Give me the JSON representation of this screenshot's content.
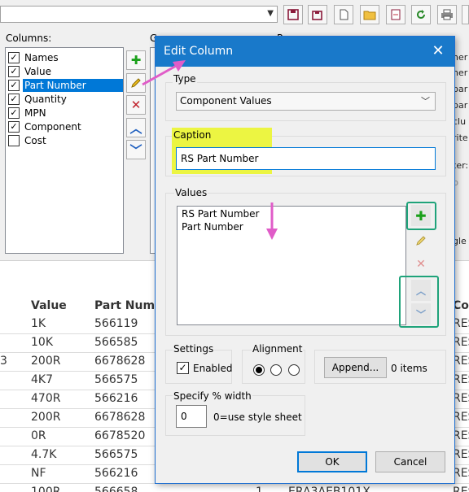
{
  "background": {
    "columns_label": "Columns:",
    "columns": [
      {
        "label": "Names",
        "checked": true,
        "selected": false
      },
      {
        "label": "Value",
        "checked": true,
        "selected": false
      },
      {
        "label": "Part Number",
        "checked": true,
        "selected": true
      },
      {
        "label": "Quantity",
        "checked": true,
        "selected": false
      },
      {
        "label": "MPN",
        "checked": true,
        "selected": false
      },
      {
        "label": "Component",
        "checked": true,
        "selected": false
      },
      {
        "label": "Cost",
        "checked": false,
        "selected": false
      }
    ],
    "partial_text": {
      "g": "G",
      "p": "P",
      "ner1": "ner",
      "ner2": "ner",
      "par1": "par",
      "par2": "par",
      "clu": "clu",
      "rite": "rite",
      "ter": "ter:",
      "p2": "p",
      "gle": "gle"
    },
    "table": {
      "headers": {
        "value": "Value",
        "part": "Part Num",
        "co": "Co"
      },
      "rows": [
        {
          "value": "1K",
          "part": "566119",
          "co": "RES"
        },
        {
          "value": "10K",
          "part": "566585",
          "co": "RES"
        },
        {
          "value": "200R",
          "part": "6678628",
          "co": "RES",
          "left": "3"
        },
        {
          "value": "4K7",
          "part": "566575",
          "co": "RES"
        },
        {
          "value": "470R",
          "part": "566216",
          "co": "RES"
        },
        {
          "value": "200R",
          "part": "6678628",
          "co": "RES"
        },
        {
          "value": "0R",
          "part": "6678520",
          "co": "RES"
        },
        {
          "value": "4.7K",
          "part": "566575",
          "co": "RES"
        },
        {
          "value": "NF",
          "part": "566216",
          "co": "RES"
        },
        {
          "value": "100R",
          "part": "566658",
          "qty": "1",
          "mpn": "ERA3AEB101X",
          "co": "RES"
        }
      ]
    }
  },
  "dialog": {
    "title": "Edit Column",
    "type_label": "Type",
    "type_value": "Component Values",
    "caption_label": "Caption",
    "caption_value": "RS Part Number",
    "values_label": "Values",
    "values": [
      "RS Part Number",
      "Part Number"
    ],
    "settings_label": "Settings",
    "enabled_label": "Enabled",
    "enabled": true,
    "alignment_label": "Alignment",
    "alignment_selected": 0,
    "append_label": "Append...",
    "items_count": "0 items",
    "width_label": "Specify % width",
    "width_value": "0",
    "width_hint": "0=use style sheet",
    "ok_label": "OK",
    "cancel_label": "Cancel"
  },
  "colors": {
    "title_bar": "#1979ca",
    "highlight": "#ecf542",
    "annotation_arrow": "#e05cc8",
    "annotation_box": "#1fa37a"
  }
}
